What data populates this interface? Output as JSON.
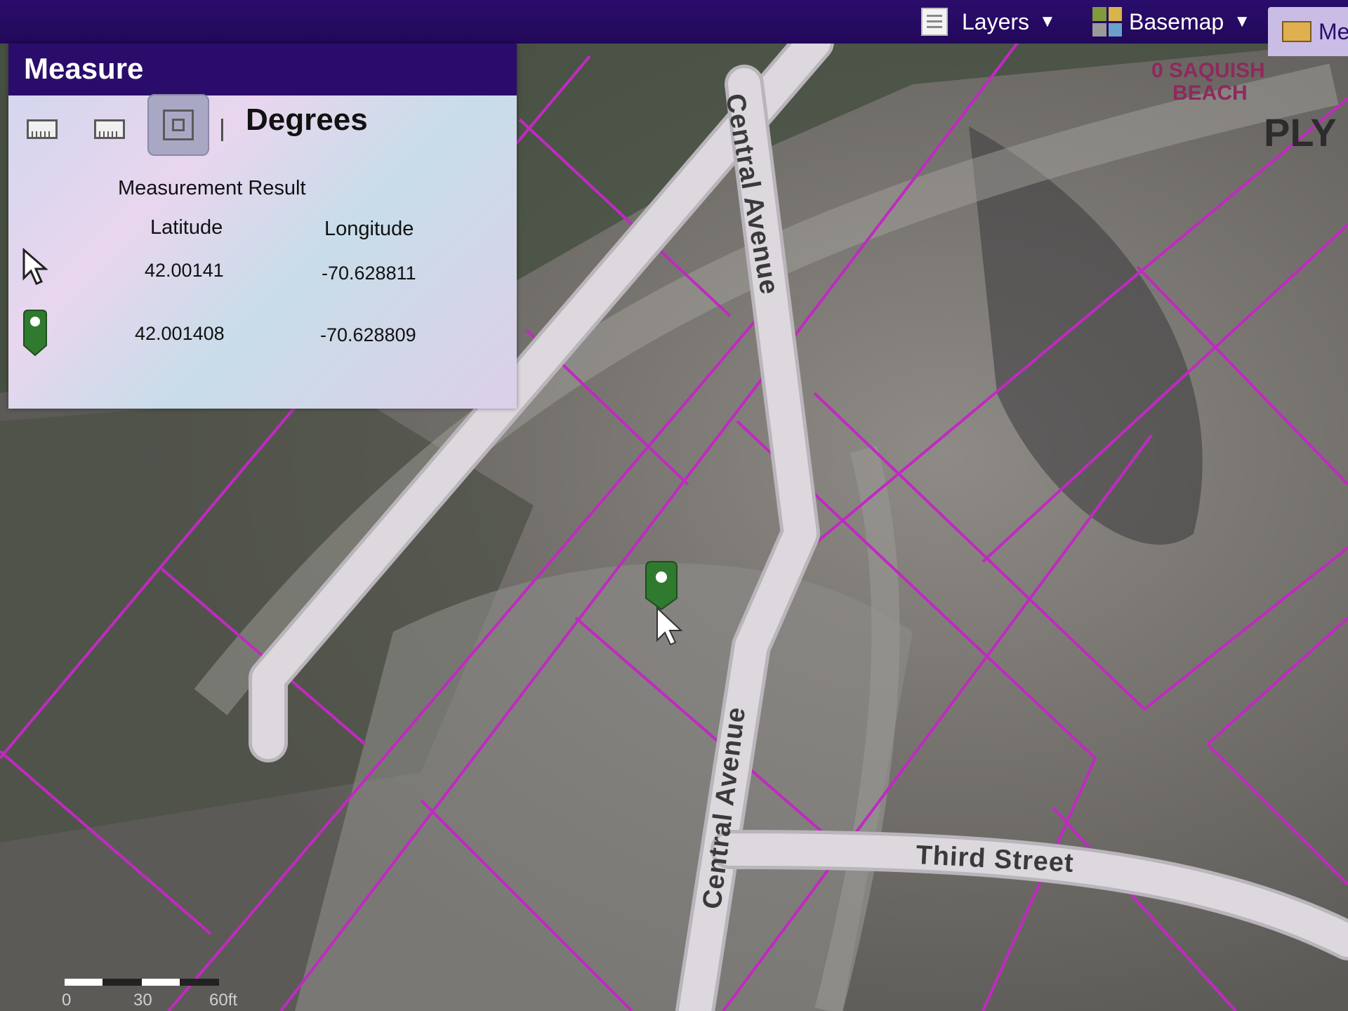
{
  "toolbar": {
    "layers_label": "Layers",
    "basemap_label": "Basemap",
    "measure_label": "Me",
    "layers_icon": "layers-list-icon",
    "basemap_icon": "basemap-grid-icon",
    "measure_icon": "ruler-icon"
  },
  "measure_panel": {
    "title": "Measure",
    "tools": [
      "area-ruler-icon",
      "distance-ruler-icon",
      "location-icon"
    ],
    "active_tool": "location",
    "separator": "|",
    "unit": "Degrees",
    "result_title": "Measurement Result",
    "columns": {
      "latitude": "Latitude",
      "longitude": "Longitude"
    },
    "rows": [
      {
        "icon": "cursor-pointer-icon",
        "latitude": "42.00141",
        "longitude": "-70.628811"
      },
      {
        "icon": "green-marker-icon",
        "latitude": "42.001408",
        "longitude": "-70.628809"
      }
    ]
  },
  "map": {
    "streets": {
      "central_upper": "Central Avenue",
      "central_lower": "Central Avenue",
      "third": "Third Street"
    },
    "places": {
      "saquish_line1": "0 SAQUISH",
      "saquish_line2": "BEACH",
      "plymouth_partial": "PLY"
    },
    "scale": {
      "labels": [
        "0",
        "30",
        "60ft"
      ]
    },
    "colors": {
      "parcel_line": "#c02ac0",
      "road": "#d8d4d8",
      "marker": "#2f7a2f",
      "toolbar_bg": "#2a0d6b"
    }
  }
}
